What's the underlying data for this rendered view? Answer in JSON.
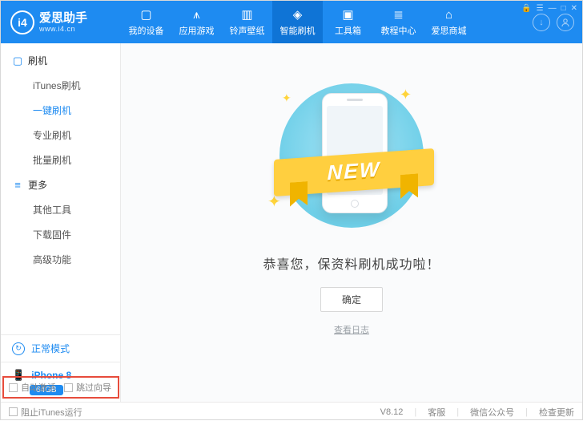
{
  "app": {
    "name": "爱思助手",
    "site": "www.i4.cn",
    "logo_mark": "i4"
  },
  "nav": {
    "items": [
      {
        "label": "我的设备",
        "icon": "phone-icon",
        "glyph": "▢"
      },
      {
        "label": "应用游戏",
        "icon": "apps-icon",
        "glyph": "⩚"
      },
      {
        "label": "铃声壁纸",
        "icon": "wallpaper-icon",
        "glyph": "▥"
      },
      {
        "label": "智能刷机",
        "icon": "flash-icon",
        "glyph": "◈",
        "active": true
      },
      {
        "label": "工具箱",
        "icon": "toolbox-icon",
        "glyph": "▣"
      },
      {
        "label": "教程中心",
        "icon": "tutorial-icon",
        "glyph": "≣"
      },
      {
        "label": "爱思商城",
        "icon": "store-icon",
        "glyph": "⌂"
      }
    ]
  },
  "header_right": {
    "download": "↓",
    "account": "◯"
  },
  "win": {
    "lock": "🔒",
    "menu": "☰",
    "min": "—",
    "max": "□",
    "close": "✕"
  },
  "sidebar": {
    "sections": [
      {
        "icon": "▢",
        "label": "刷机",
        "items": [
          {
            "label": "iTunes刷机"
          },
          {
            "label": "一键刷机",
            "active": true
          },
          {
            "label": "专业刷机"
          },
          {
            "label": "批量刷机"
          }
        ]
      },
      {
        "icon": "≡",
        "label": "更多",
        "items": [
          {
            "label": "其他工具"
          },
          {
            "label": "下载固件"
          },
          {
            "label": "高级功能"
          }
        ]
      }
    ],
    "mode": {
      "icon": "↻",
      "label": "正常模式"
    },
    "device": {
      "icon": "📱",
      "name": "iPhone 8",
      "storage": "64GB"
    }
  },
  "content": {
    "ribbon": "NEW",
    "success": "恭喜您，保资料刷机成功啦！",
    "ok": "确定",
    "log": "查看日志"
  },
  "foot": {
    "auto_activate": "自动激活",
    "skip_guide": "跳过向导"
  },
  "status": {
    "block_itunes": "阻止iTunes运行",
    "version": "V8.12",
    "support": "客服",
    "wechat": "微信公众号",
    "update": "检查更新"
  }
}
